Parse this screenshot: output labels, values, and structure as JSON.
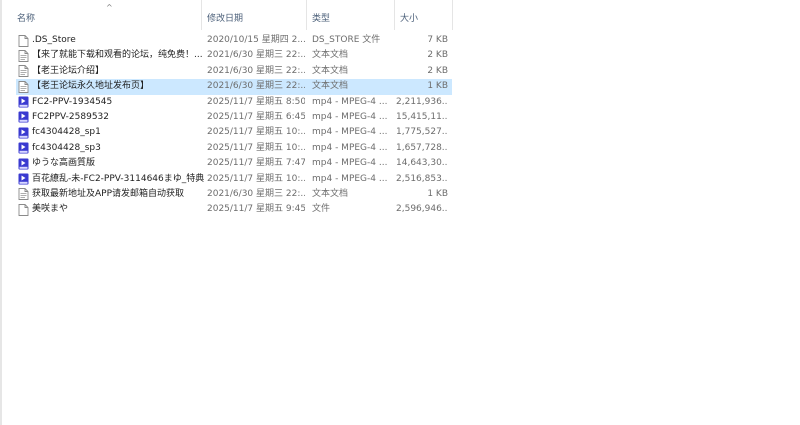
{
  "columns": {
    "name": "名称",
    "date": "修改日期",
    "type": "类型",
    "size": "大小"
  },
  "sort_indicator": "^",
  "files": [
    {
      "name": ".DS_Store",
      "date": "2020/10/15 星期四 2...",
      "type": "DS_STORE 文件",
      "size": "7 KB",
      "icon": "document-icon"
    },
    {
      "name": "【来了就能下载和观看的论坛，纯免费！...",
      "date": "2021/6/30 星期三 22:...",
      "type": "文本文档",
      "size": "2 KB",
      "icon": "text-document-icon"
    },
    {
      "name": "【老王论坛介绍】",
      "date": "2021/6/30 星期三 22:...",
      "type": "文本文档",
      "size": "2 KB",
      "icon": "text-document-icon"
    },
    {
      "name": "【老王论坛永久地址发布页】",
      "date": "2021/6/30 星期三 22:...",
      "type": "文本文档",
      "size": "1 KB",
      "icon": "text-document-icon",
      "selected": true
    },
    {
      "name": "FC2-PPV-1934545",
      "date": "2025/11/7 星期五 8:50",
      "type": "mp4 - MPEG-4 ...",
      "size": "2,211,936...",
      "icon": "video-player-icon"
    },
    {
      "name": "FC2PPV-2589532",
      "date": "2025/11/7 星期五 6:45",
      "type": "mp4 - MPEG-4 ...",
      "size": "15,415,11...",
      "icon": "video-player-icon"
    },
    {
      "name": "fc4304428_sp1",
      "date": "2025/11/7 星期五 10:...",
      "type": "mp4 - MPEG-4 ...",
      "size": "1,775,527...",
      "icon": "video-player-icon"
    },
    {
      "name": "fc4304428_sp3",
      "date": "2025/11/7 星期五 10:...",
      "type": "mp4 - MPEG-4 ...",
      "size": "1,657,728...",
      "icon": "video-player-icon"
    },
    {
      "name": "ゆうな高画質版",
      "date": "2025/11/7 星期五 7:47",
      "type": "mp4 - MPEG-4 ...",
      "size": "14,643,30...",
      "icon": "video-player-icon"
    },
    {
      "name": "百花繚乱-未-FC2-PPV-3114646まゆ_特典",
      "date": "2025/11/7 星期五 10:...",
      "type": "mp4 - MPEG-4 ...",
      "size": "2,516,853...",
      "icon": "video-player-icon"
    },
    {
      "name": "获取最新地址及APP请发邮箱自动获取",
      "date": "2021/6/30 星期三 22:...",
      "type": "文本文档",
      "size": "1 KB",
      "icon": "text-document-icon"
    },
    {
      "name": "美咲まや",
      "date": "2025/11/7 星期五 9:45",
      "type": "文件",
      "size": "2,596,946...",
      "icon": "document-icon"
    }
  ],
  "colors": {
    "header_text": "#4c607a",
    "selection": "#cce8ff",
    "video_icon": "#3a3ad0",
    "meta_text": "#6d6d6d"
  }
}
